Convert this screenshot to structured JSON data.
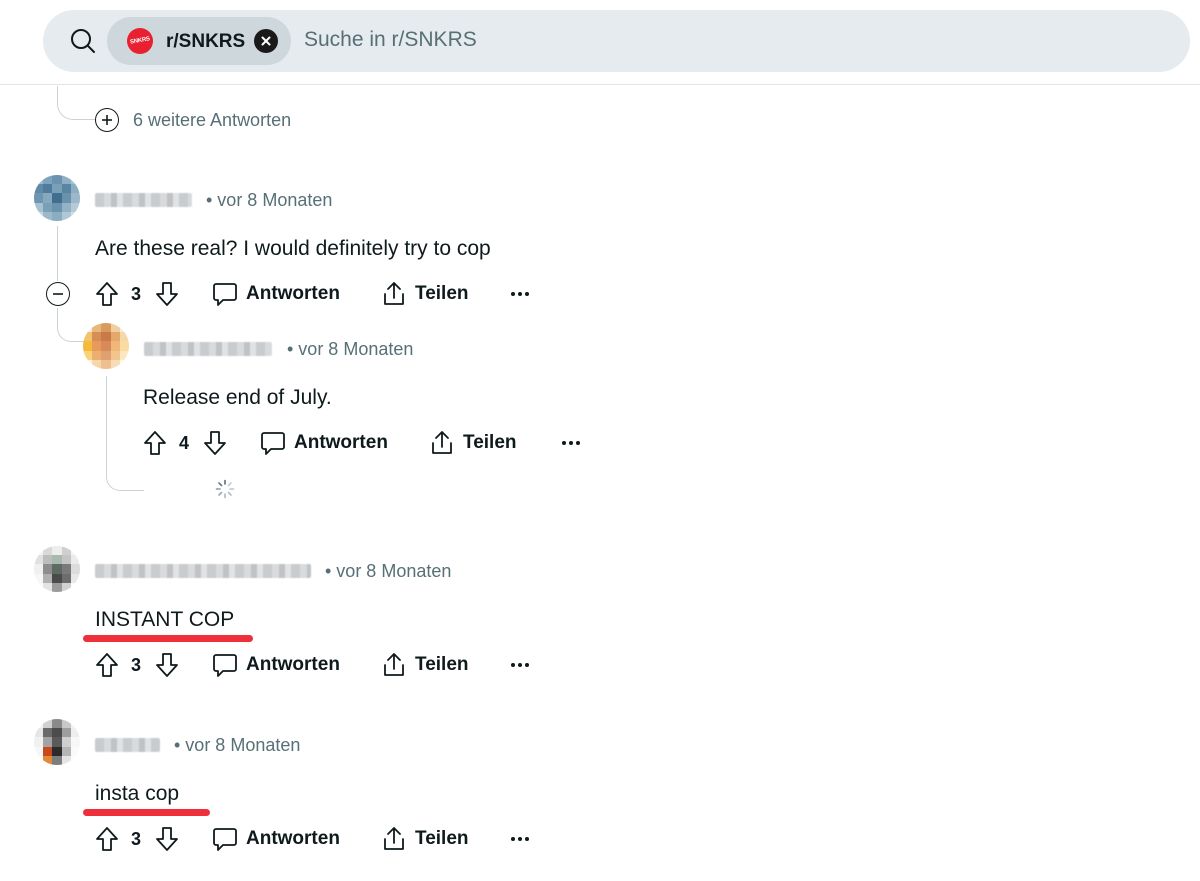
{
  "search": {
    "community_chip": "r/SNKRS",
    "chip_logo_text": "SNKRS",
    "placeholder": "Suche in r/SNKRS"
  },
  "thread": {
    "more_replies_label": "6 weitere Antworten"
  },
  "comments": [
    {
      "meta": "• vor 8 Monaten",
      "text": "Are these real? I would definitely try to cop",
      "score": "3",
      "reply_label": "Antworten",
      "share_label": "Teilen"
    },
    {
      "meta": "• vor 8 Monaten",
      "text": "Release end of July.",
      "score": "4",
      "reply_label": "Antworten",
      "share_label": "Teilen"
    },
    {
      "meta": "• vor 8 Monaten",
      "text": "INSTANT COP",
      "score": "3",
      "reply_label": "Antworten",
      "share_label": "Teilen"
    },
    {
      "meta": "• vor 8 Monaten",
      "text": "insta cop",
      "score": "3",
      "reply_label": "Antworten",
      "share_label": "Teilen"
    }
  ],
  "icons": {
    "search": "search-icon",
    "close": "close-icon",
    "expand": "plus-circle-icon",
    "collapse": "minus-circle-icon",
    "upvote": "upvote-icon",
    "downvote": "downvote-icon",
    "reply": "comment-icon",
    "share": "share-icon",
    "more": "more-icon",
    "loading": "loading-spinner-icon"
  },
  "colors": {
    "search_bg": "#e5ebee",
    "chip_bg": "#cdd7dc",
    "brand_red": "#e8202f",
    "highlight_red": "#ef2f3a",
    "meta_gray": "#576f76"
  }
}
